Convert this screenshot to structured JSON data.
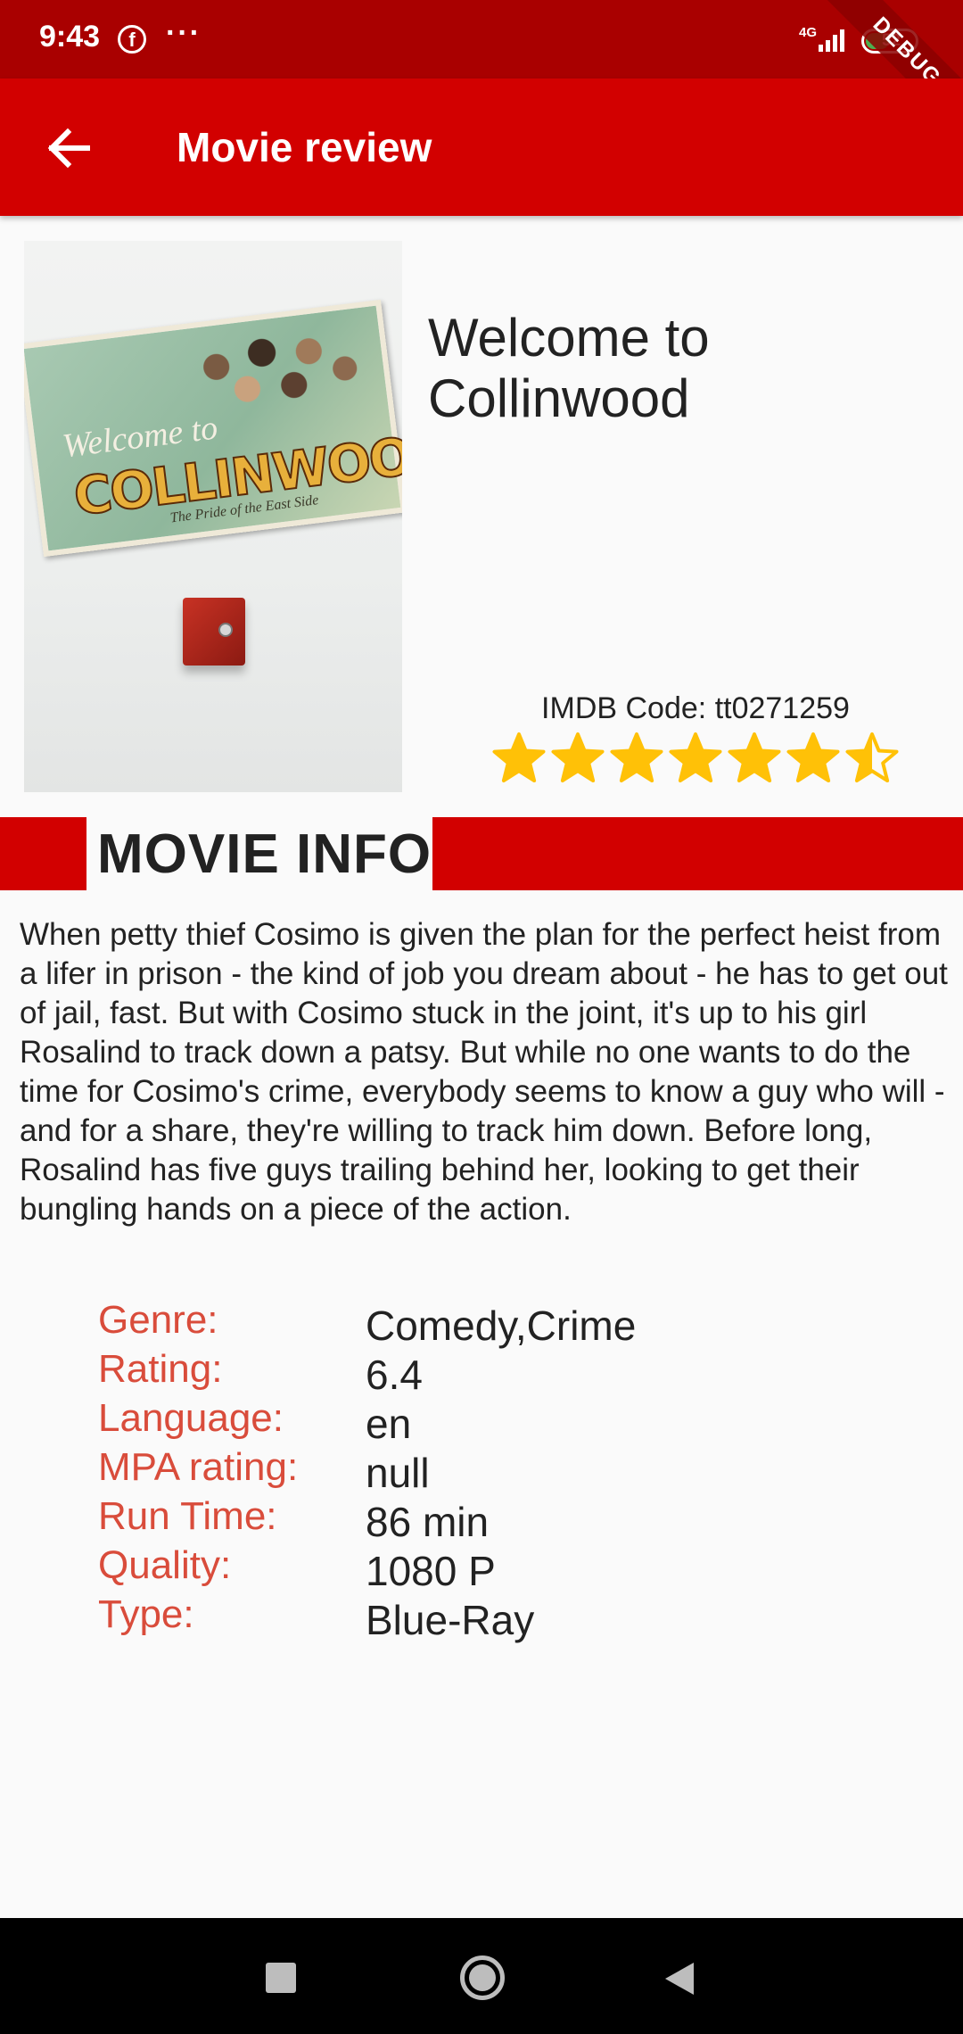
{
  "status_bar": {
    "time": "9:43",
    "notification_icon": "facebook-icon",
    "more_icon": "ellipsis-icon",
    "network_label": "4G",
    "battery_level": "52",
    "debug_banner": "DEBUG"
  },
  "app_bar": {
    "back_icon": "arrow-left-icon",
    "title": "Movie review",
    "background_color": "#d20000"
  },
  "movie": {
    "title": "Welcome to Collinwood",
    "poster": {
      "script_text": "Welcome to",
      "big_text": "COLLINWOOD",
      "tagline": "The Pride of the East Side"
    },
    "imdb_label": "IMDB Code:",
    "imdb_code": "tt0271259",
    "star_rating": 6.5,
    "star_max": 7,
    "star_color": "#ffc107"
  },
  "section": {
    "title": "MOVIE INFO"
  },
  "description": "When petty thief Cosimo is given the plan for the perfect heist from a lifer in prison - the kind of job you dream about - he has to get out of jail, fast. But with Cosimo stuck in the joint, it's up to his girl Rosalind to track down a patsy. But while no one wants to do the time for Cosimo's crime, everybody seems to know a guy who will - and for a share, they're willing to track him down. Before long, Rosalind has five guys trailing behind her, looking to get their bungling hands on a piece of the action.",
  "info": {
    "label_color": "#d94c3b",
    "rows": [
      {
        "label": "Genre:",
        "value": "Comedy,Crime"
      },
      {
        "label": "Rating:",
        "value": "6.4"
      },
      {
        "label": "Language:",
        "value": "en"
      },
      {
        "label": "MPA rating:",
        "value": "null"
      },
      {
        "label": "Run Time:",
        "value": "86 min"
      },
      {
        "label": "Quality:",
        "value": "1080 P"
      },
      {
        "label": "Type:",
        "value": "Blue-Ray"
      }
    ]
  },
  "nav_bar": {
    "recents_icon": "square-icon",
    "home_icon": "circle-home-icon",
    "back_icon": "triangle-back-icon"
  }
}
